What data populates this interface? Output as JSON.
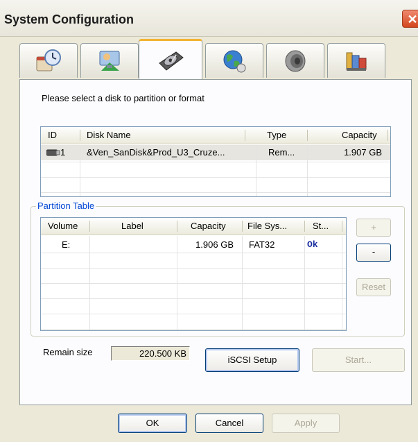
{
  "window": {
    "title": "System Configuration",
    "close_glyph": "✕"
  },
  "tabs": [
    {
      "icon": "clock-calendar-icon",
      "active": false
    },
    {
      "icon": "user-monitor-icon",
      "active": false
    },
    {
      "icon": "hard-disk-icon",
      "active": true
    },
    {
      "icon": "globe-network-icon",
      "active": false
    },
    {
      "icon": "speaker-icon",
      "active": false
    },
    {
      "icon": "toolbox-icon",
      "active": false
    }
  ],
  "disk_section": {
    "prompt": "Please select a disk to partition or format",
    "columns": [
      "ID",
      "Disk Name",
      "Type",
      "Capacity"
    ],
    "rows": [
      {
        "id": "1",
        "icon": "usb-drive-icon",
        "name": "&Ven_SanDisk&Prod_U3_Cruze...",
        "type": "Rem...",
        "capacity": "1.907 GB"
      }
    ]
  },
  "partition_table": {
    "label": "Partition Table",
    "columns": [
      "Volume",
      "Label",
      "Capacity",
      "File Sys...",
      "St..."
    ],
    "rows": [
      {
        "volume": "E:",
        "label": "",
        "capacity": "1.906 GB",
        "filesystem": "FAT32",
        "status": "Ok"
      }
    ],
    "buttons": {
      "add": "+",
      "remove": "-",
      "reset": "Reset"
    }
  },
  "remain": {
    "label": "Remain size",
    "value": "220.500 KB"
  },
  "actions": {
    "iscsi": "iSCSI Setup",
    "start": "Start..."
  },
  "footer": {
    "ok": "OK",
    "cancel": "Cancel",
    "apply": "Apply"
  },
  "colors": {
    "accent_tab": "#f2b333",
    "status_ok": "#1c2fa1",
    "group_label": "#0046d5"
  }
}
